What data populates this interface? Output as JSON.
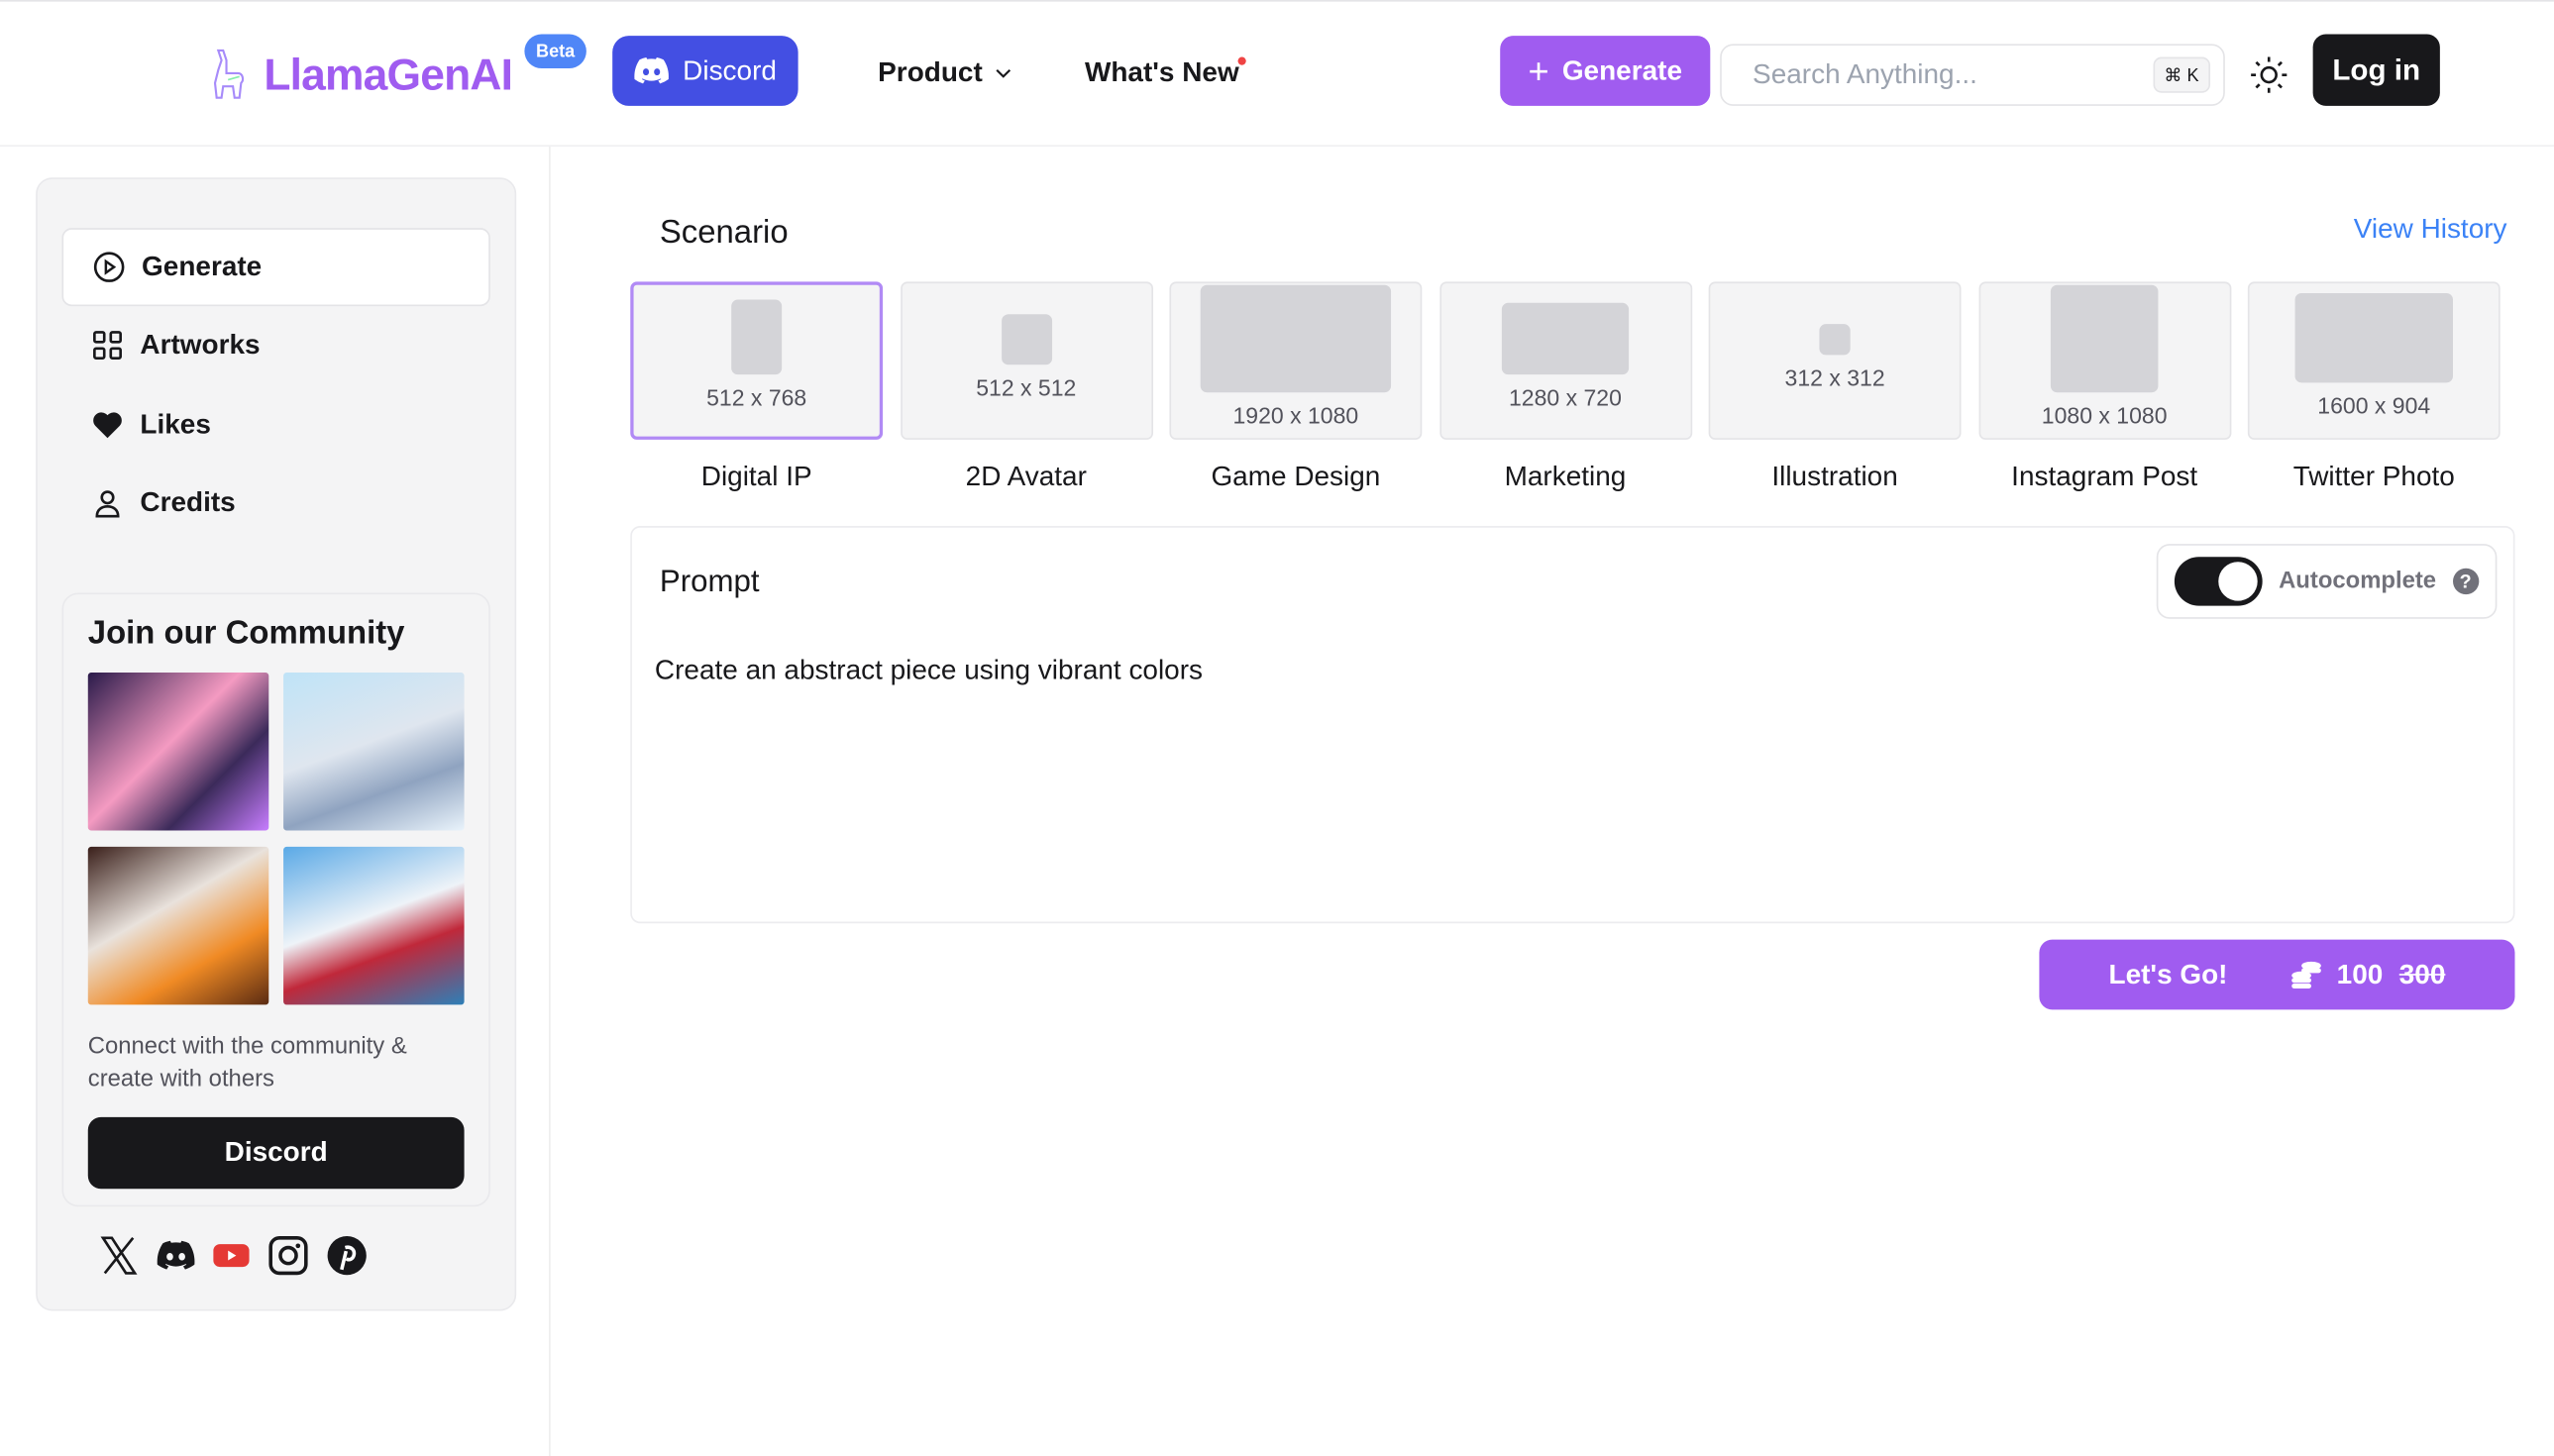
{
  "header": {
    "logo": "LlamaGenAI",
    "beta": "Beta",
    "discord": "Discord",
    "product": "Product",
    "whats_new": "What's New",
    "generate": "Generate",
    "search_placeholder": "Search Anything...",
    "search_shortcut": "⌘ K",
    "login": "Log in"
  },
  "sidebar": {
    "items": [
      {
        "label": "Generate",
        "icon": "play-circle-icon"
      },
      {
        "label": "Artworks",
        "icon": "grid-icon"
      },
      {
        "label": "Likes",
        "icon": "heart-icon"
      },
      {
        "label": "Credits",
        "icon": "user-icon"
      }
    ],
    "community": {
      "title": "Join our Community",
      "text": "Connect with the community & create with others",
      "button": "Discord"
    },
    "socials": [
      "x-icon",
      "discord-icon",
      "youtube-icon",
      "instagram-icon",
      "pinterest-icon"
    ]
  },
  "main": {
    "scenario_title": "Scenario",
    "view_history": "View History",
    "scenarios": [
      {
        "label": "Digital IP",
        "size": "512 x 768",
        "selected": true
      },
      {
        "label": "2D Avatar",
        "size": "512 x 512"
      },
      {
        "label": "Game Design",
        "size": "1920 x 1080"
      },
      {
        "label": "Marketing",
        "size": "1280 x 720"
      },
      {
        "label": "Illustration",
        "size": "312 x 312"
      },
      {
        "label": "Instagram Post",
        "size": "1080 x 1080"
      },
      {
        "label": "Twitter Photo",
        "size": "1600 x 904"
      }
    ],
    "prompt_label": "Prompt",
    "autocomplete": "Autocomplete",
    "autocomplete_on": true,
    "prompt_text": "Create an abstract piece using vibrant colors",
    "go": {
      "label": "Let's Go!",
      "cost": "100",
      "old_cost": "300"
    }
  },
  "colors": {
    "accent": "#a05cf0",
    "discord": "#434fe3",
    "link": "#3b82f6",
    "dark": "#18181b"
  }
}
